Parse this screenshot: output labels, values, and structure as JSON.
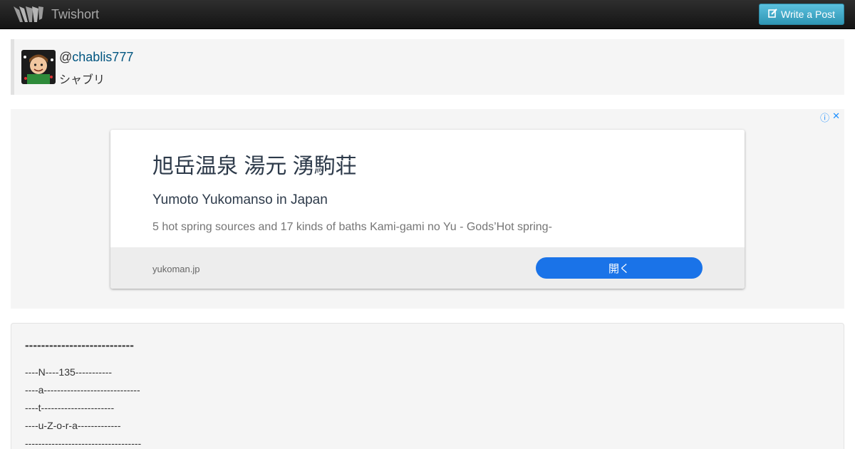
{
  "navbar": {
    "brand_name": "Twishort",
    "write_button_label": "Write a Post",
    "write_icon": "edit-icon",
    "logo_icon": "twishort-logo-icon"
  },
  "profile": {
    "at_sign": "@",
    "handle": "chablis777",
    "display_name": "シャブリ",
    "avatar_icon": "avatar-image"
  },
  "ad": {
    "info_icon": "ⓘ",
    "close_icon": "✕",
    "title": "旭岳温泉 湯元 湧駒荘",
    "subtitle": "Yumoto Yukomanso in Japan",
    "description": "5 hot spring sources and 17 kinds of baths Kami-gami no Yu - Gods’Hot spring-",
    "domain": "yukoman.jp",
    "open_button_label": "開く",
    "accent_color": "#1a73e8"
  },
  "post": {
    "heading": "---------------------------",
    "lines": [
      "----N----135-----------",
      "----a-----------------------------",
      "----t----------------------",
      "----u-Z-o-r-a-------------",
      "-----------------------------------"
    ]
  }
}
